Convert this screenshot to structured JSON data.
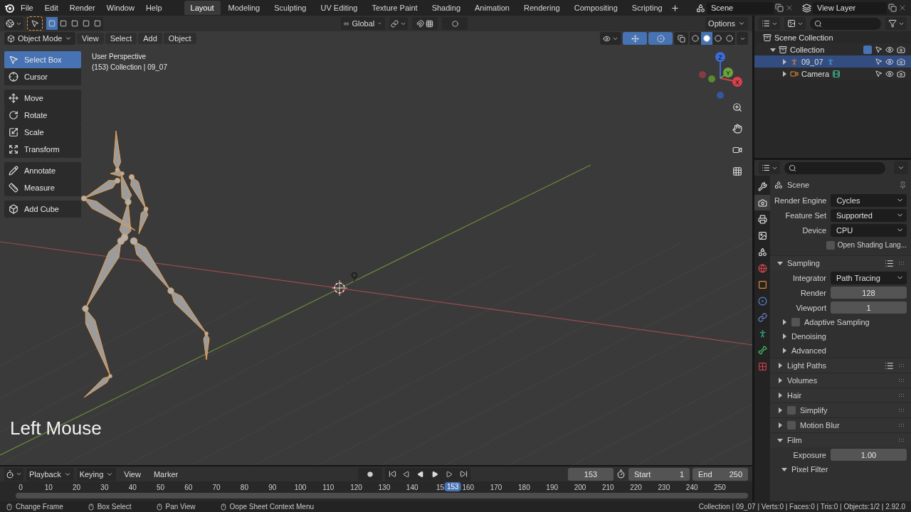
{
  "menu": [
    "File",
    "Edit",
    "Render",
    "Window",
    "Help"
  ],
  "workspaces": [
    {
      "label": "Layout",
      "selected": true
    },
    {
      "label": "Modeling",
      "selected": false
    },
    {
      "label": "Sculpting",
      "selected": false
    },
    {
      "label": "UV Editing",
      "selected": false
    },
    {
      "label": "Texture Paint",
      "selected": false
    },
    {
      "label": "Shading",
      "selected": false
    },
    {
      "label": "Animation",
      "selected": false
    },
    {
      "label": "Rendering",
      "selected": false
    },
    {
      "label": "Compositing",
      "selected": false
    },
    {
      "label": "Scripting",
      "selected": false
    }
  ],
  "scene": "Scene",
  "view_layer": "View Layer",
  "tool_header": {
    "select_modes": [
      {
        "selected": true
      },
      {
        "selected": false
      },
      {
        "selected": false
      },
      {
        "selected": false
      },
      {
        "selected": false
      }
    ],
    "orientation": "Global",
    "options": "Options"
  },
  "viewport": {
    "mode": "Object Mode",
    "menus": [
      "View",
      "Select",
      "Add",
      "Object"
    ],
    "shading": [
      {
        "selected": false
      },
      {
        "selected": true
      },
      {
        "selected": false
      },
      {
        "selected": false
      }
    ],
    "perspective": "User Perspective",
    "info": "(153) Collection | 09_07",
    "overlay_text": "Left Mouse",
    "gizmo_axes": [
      "X",
      "Y",
      "Z"
    ],
    "tool_groups": [
      [
        {
          "kind": "select",
          "label": "Select Box",
          "selected": true
        },
        {
          "kind": "cursor",
          "label": "Cursor",
          "selected": false
        }
      ],
      [
        {
          "kind": "move",
          "label": "Move",
          "selected": false
        },
        {
          "kind": "rotate",
          "label": "Rotate",
          "selected": false
        },
        {
          "kind": "scale",
          "label": "Scale",
          "selected": false
        },
        {
          "kind": "transform",
          "label": "Transform",
          "selected": false
        }
      ],
      [
        {
          "kind": "annotate",
          "label": "Annotate",
          "selected": false
        },
        {
          "kind": "measure",
          "label": "Measure",
          "selected": false
        }
      ],
      [
        {
          "kind": "add",
          "label": "Add Cube",
          "selected": false
        }
      ]
    ]
  },
  "outliner": {
    "root": "Scene Collection",
    "items": [
      {
        "kind": "collection",
        "label": "Collection",
        "expanded": true,
        "checked": true,
        "selected": false,
        "children": [
          {
            "kind": "armature",
            "label": "09_07",
            "selected": true
          },
          {
            "kind": "camera",
            "label": "Camera",
            "selected": false
          }
        ]
      }
    ]
  },
  "properties": {
    "context": "Scene",
    "tabs": [
      {
        "kind": "tool",
        "selected": false
      },
      {
        "kind": "render",
        "selected": true
      },
      {
        "kind": "output",
        "selected": false
      },
      {
        "kind": "view_layer",
        "selected": false
      },
      {
        "kind": "scene",
        "selected": false
      },
      {
        "kind": "world",
        "selected": false
      },
      {
        "kind": "object",
        "selected": false
      },
      {
        "kind": "physics",
        "selected": false
      },
      {
        "kind": "constraints",
        "selected": false
      },
      {
        "kind": "data",
        "selected": false
      },
      {
        "kind": "bone",
        "selected": false
      },
      {
        "kind": "texture",
        "selected": false
      }
    ],
    "fields": [
      {
        "kind": "dropdown",
        "label": "Render Engine",
        "value": "Cycles"
      },
      {
        "kind": "dropdown",
        "label": "Feature Set",
        "value": "Supported"
      },
      {
        "kind": "dropdown",
        "label": "Device",
        "value": "CPU"
      },
      {
        "kind": "checkbox",
        "label": "Open Shading Lang...",
        "checked": false
      }
    ],
    "panels": [
      {
        "title": "Sampling",
        "expanded": true,
        "presets": true,
        "fields": [
          {
            "kind": "dropdown",
            "label": "Integrator",
            "value": "Path Tracing"
          },
          {
            "kind": "number",
            "label": "Render",
            "value": "128"
          },
          {
            "kind": "number",
            "label": "Viewport",
            "value": "1"
          }
        ],
        "subpanels": [
          {
            "title": "Adaptive Sampling",
            "expanded": false,
            "checked": false
          },
          {
            "title": "Denoising",
            "expanded": false
          },
          {
            "title": "Advanced",
            "expanded": false
          }
        ]
      },
      {
        "title": "Light Paths",
        "expanded": false,
        "presets": true
      },
      {
        "title": "Volumes",
        "expanded": false,
        "presets": false
      },
      {
        "title": "Hair",
        "expanded": false,
        "presets": false
      },
      {
        "title": "Simplify",
        "expanded": false,
        "presets": false,
        "checked": false
      },
      {
        "title": "Motion Blur",
        "expanded": false,
        "presets": false,
        "checked": false
      },
      {
        "title": "Film",
        "expanded": true,
        "presets": false,
        "fields": [
          {
            "kind": "number",
            "label": "Exposure",
            "value": "1.00"
          }
        ],
        "subpanels": [
          {
            "title": "Pixel Filter",
            "expanded": true
          }
        ]
      }
    ]
  },
  "timeline": {
    "menus": [
      {
        "label": "Playback",
        "dropdown": true
      },
      {
        "label": "Keying",
        "dropdown": true
      },
      {
        "label": "View",
        "dropdown": false
      },
      {
        "label": "Marker",
        "dropdown": false
      }
    ],
    "current_frame": "153",
    "start_label": "Start",
    "start": "1",
    "end_label": "End",
    "end": "250",
    "ruler": [
      "0",
      "10",
      "20",
      "30",
      "40",
      "50",
      "60",
      "70",
      "80",
      "90",
      "100",
      "110",
      "120",
      "130",
      "140",
      "15",
      "160",
      "170",
      "180",
      "190",
      "200",
      "210",
      "220",
      "230",
      "240",
      "250"
    ],
    "marker": {
      "label": "153",
      "level": 0.602
    }
  },
  "status_bar": {
    "hints": [
      "Change Frame",
      "Box Select",
      "Pan View",
      "Oope Sheet Context Menu"
    ],
    "stats": "Collection | 09_07 | Verts:0 | Faces:0 | Tris:0 | Objects:1/2 | 2.92.0"
  }
}
